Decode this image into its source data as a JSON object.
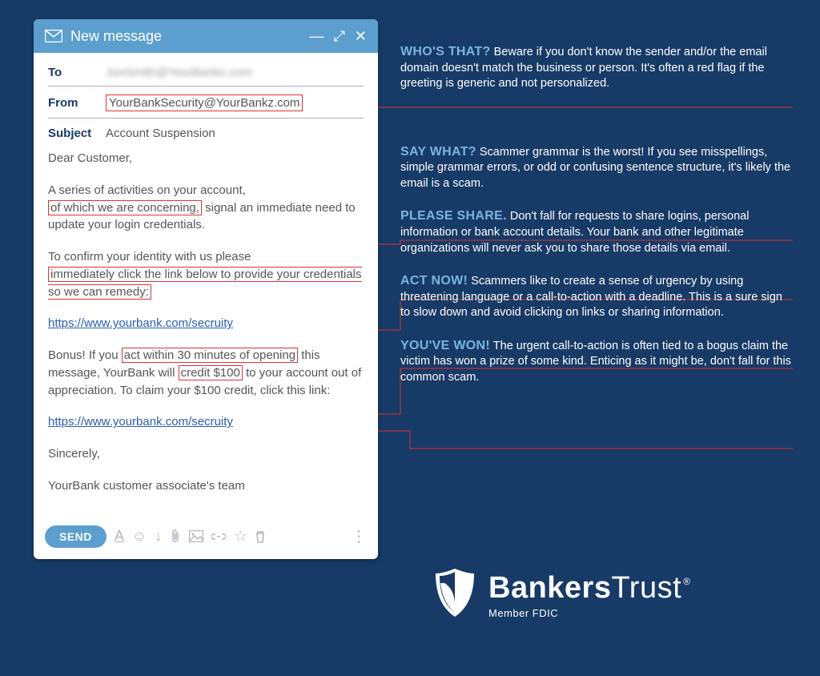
{
  "email": {
    "window_title": "New message",
    "to_label": "To",
    "to_value": "JonSmith@YourBankz.com",
    "from_label": "From",
    "from_value": "YourBankSecurity@YourBankz.com",
    "subject_label": "Subject",
    "subject_value": "Account Suspension",
    "body": {
      "greeting": "Dear Customer,",
      "p1_before": "A series of activities on your account,",
      "p1_red": "of which we are concerning,",
      "p1_after": " signal an immediate need to update your login credentials.",
      "p2_before": "To confirm your identity with us please ",
      "p2_red": "immediately click the link below to provide your credentials so we can remedy:",
      "link1": "https://www.yourbank.com/secruity",
      "p3_a": "Bonus! If you ",
      "p3_red1": "act within 30 minutes of opening",
      "p3_b": " this message, YourBank will ",
      "p3_red2": "credit $100",
      "p3_c": " to your account out of appreciation. To claim your $100 credit, click this link:",
      "link2": "https://www.yourbank.com/secruity",
      "signoff": "Sincerely,",
      "sig": "YourBank customer associate's team"
    },
    "send_label": "SEND"
  },
  "callouts": [
    {
      "title": "WHO'S THAT?",
      "text": " Beware if you don't know the sender and/or the email domain doesn't match the business or person. It's often a red flag if the greeting is generic and not personalized."
    },
    {
      "title": "SAY WHAT?",
      "text": " Scammer grammar is the worst! If you see misspellings, simple grammar errors, or odd or confusing sentence structure, it's likely the email is a scam."
    },
    {
      "title": "PLEASE SHARE.",
      "text": " Don't fall for requests to share logins, personal information or bank account details. Your bank and other legitimate organizations will never ask you to share those details via email."
    },
    {
      "title": "ACT NOW!",
      "text": " Scammers like to create a sense of urgency by using threatening language or a call-to-action with a deadline. This is a sure sign to slow down and avoid clicking on links or sharing information."
    },
    {
      "title": "YOU'VE WON!",
      "text": " The urgent call-to-action is often tied to a bogus claim the victim has won a prize of some kind. Enticing as it might be, don't fall for this common scam."
    }
  ],
  "brand": {
    "name_bold": "Bankers",
    "name_rest": "Trust",
    "subline": "Member FDIC"
  }
}
